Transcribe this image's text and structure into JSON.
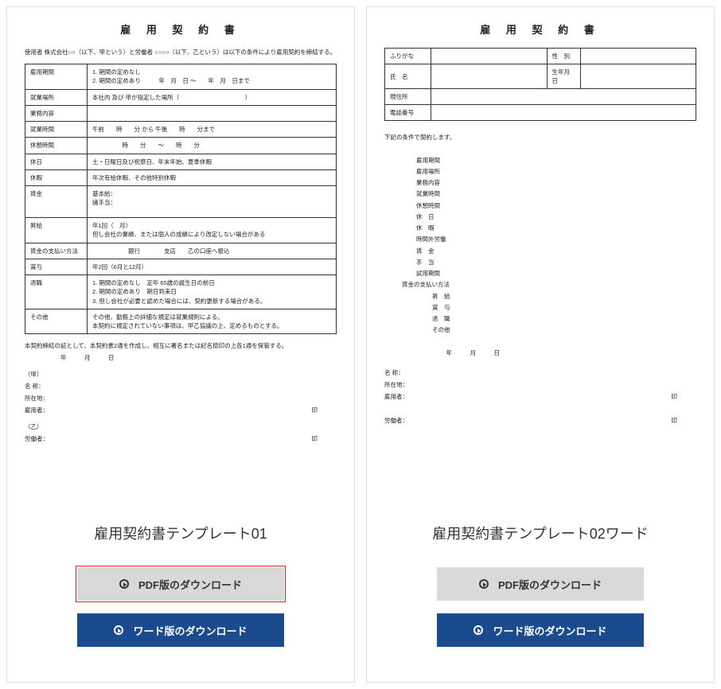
{
  "doc1": {
    "title": "雇 用 契 約 書",
    "intro": "使用者 株式会社○○（以下、甲という）と労働者 ○○○○（以下、乙という）は以下の条件により雇用契約を締結する。",
    "rows": {
      "r1_label": "雇用期間",
      "r1_val": "1. 期間の定めなし\n2. 期間の定めあり　　　年　月　日 ～　　年　月　日まで",
      "r2_label": "就業場所",
      "r2_val": "本社内 及び 甲が指定した場所（　　　　　　　　　　　）",
      "r3_label": "業務内容",
      "r3_val": "",
      "r4_label": "就業時間",
      "r4_val": "午前　　時　　分 から 午後　　時　　分まで",
      "r5_label": "休憩時間",
      "r5_val": "　　　　　時　　分　　～　　時　　分",
      "r6_label": "休日",
      "r6_val": "土・日曜日及び祝祭日、年末年始、夏季休暇",
      "r7_label": "休暇",
      "r7_val": "年次有給休暇、その他特別休暇",
      "r8_label": "賃金",
      "r8_val": "基本給：\n諸手当：",
      "r9_label": "昇給",
      "r9_val": "年1回（　月）\n但し会社の業績、または個人の成績により改定しない場合がある",
      "r10_label": "賃金の支払い方法",
      "r10_val": "　　　　　　銀行　　　　支店　　乙の口座へ振込",
      "r11_label": "賞与",
      "r11_val": "年2回（6月と12月）",
      "r12_label": "退職",
      "r12_val": "1. 期間の定めなし　定年 65歳の誕生日の前日\n2. 期間の定めあり　期日到来日\n3. 但し会社が必要と認めた場合には、契約更新する場合がある。",
      "r13_label": "その他",
      "r13_val": "その他、勤務上の詳細な規定は就業規則による。\n本契約に規定されていない事項は、甲乙協議の上、定めるものとする。"
    },
    "closing": "本契約締結の証として、本契約書2通を作成し、相互に署名または記名捺印の上各1通を保管する。\n　　　　　　年　　　月　　　日",
    "sig_a_head": "（甲）",
    "sig_a_name": "名 称：",
    "sig_a_addr": "所在地：",
    "sig_a_emp": "雇用者：",
    "sig_b_head": "（乙）",
    "sig_b_work": "労働者：",
    "stamp": "印"
  },
  "doc2": {
    "title": "雇 用 契 約 書",
    "header": {
      "furigana_l": "ふりがな",
      "sex_l": "性　別",
      "name_l": "氏　名",
      "dob_l": "生年月日",
      "addr_l": "現住所",
      "tel_l": "電話番号"
    },
    "lead": "下記の条件で契約します。",
    "items": {
      "i1": "雇用期間",
      "i2": "雇用場所",
      "i3": "業務内容",
      "i4": "就業時間",
      "i5": "休憩時間",
      "i6": "休　日",
      "i7": "休　暇",
      "i8": "時間外労働",
      "i9": "賃　金",
      "i10": "手　当",
      "i11": "試用期間",
      "i12": "賃金の支払い方法",
      "i13": "昇　給",
      "i14": "賞　与",
      "i15": "退　職",
      "i16": "その他"
    },
    "date": "　　　　　年　　　月　　　日",
    "sig_name": "名 称：",
    "sig_addr": "所在地：",
    "sig_emp": "雇用者：",
    "sig_work": "労働者：",
    "stamp": "印"
  },
  "cards": {
    "c1": {
      "label": "雇用契約書テンプレート01",
      "pdf_btn": "PDF版のダウンロード",
      "word_btn": "ワード版のダウンロード"
    },
    "c2": {
      "label": "雇用契約書テンプレート02ワード",
      "pdf_btn": "PDF版のダウンロード",
      "word_btn": "ワード版のダウンロード"
    }
  }
}
